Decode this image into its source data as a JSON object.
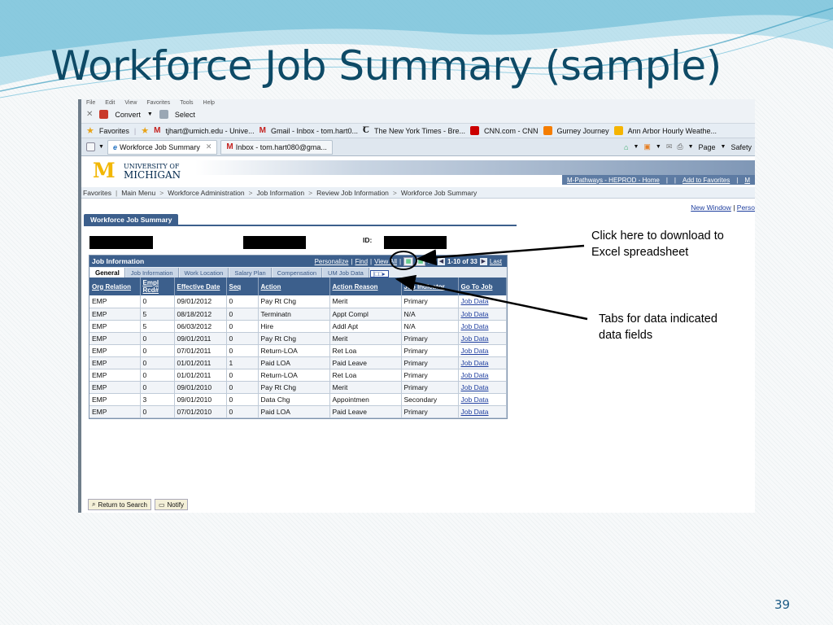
{
  "slide": {
    "title": "Workforce Job Summary (sample)",
    "number": "39",
    "colors": {
      "title": "#0e4a66",
      "wave": "#7fc6dd",
      "accent": "#3c5f8c"
    }
  },
  "browser": {
    "menu_items": [
      "File",
      "Edit",
      "View",
      "Favorites",
      "Tools",
      "Help"
    ],
    "command_bar": {
      "convert": "Convert",
      "select": "Select"
    },
    "favorites": {
      "label": "Favorites",
      "items": [
        "tjhart@umich.edu - Unive...",
        "Gmail - Inbox - tom.hart0...",
        "The New York Times - Bre...",
        "CNN.com - CNN",
        "Gurney Journey",
        "Ann Arbor Hourly Weathe..."
      ]
    },
    "tabs": [
      {
        "label": "Workforce Job Summary",
        "active": true
      },
      {
        "label": "Inbox - tom.hart080@gma...",
        "active": false
      }
    ],
    "tools": {
      "page": "Page",
      "safety": "Safety"
    }
  },
  "app": {
    "logo": {
      "line1": "UNIVERSITY OF",
      "line2": "MICHIGAN"
    },
    "banner_links": [
      "M-Pathways - HEPROD - Home",
      "Add to Favorites",
      "M"
    ],
    "breadcrumbs": [
      "Favorites",
      "Main Menu",
      "Workforce Administration",
      "Job Information",
      "Review Job Information",
      "Workforce Job Summary"
    ],
    "top_links": {
      "new_window": "New Window",
      "personalize": "Perso"
    },
    "page_tab": "Workforce Job Summary",
    "id_label": "ID:",
    "grid": {
      "title": "Job Information",
      "nav": {
        "personalize": "Personalize",
        "find": "Find",
        "view_all": "View All",
        "first": "rst",
        "range": "1-10 of 33",
        "last": "Last"
      },
      "tabs": [
        "General",
        "Job Information",
        "Work Location",
        "Salary Plan",
        "Compensation",
        "UM Job Data"
      ],
      "more_tab": "|□□▸",
      "columns": [
        "Org Relation",
        "Empl Rcd#",
        "Effective Date",
        "Seq",
        "Action",
        "Action Reason",
        "Job Indicator",
        "Go To Job"
      ],
      "rows": [
        [
          "EMP",
          "0",
          "09/01/2012",
          "0",
          "Pay Rt Chg",
          "Merit",
          "Primary",
          "Job Data"
        ],
        [
          "EMP",
          "5",
          "08/18/2012",
          "0",
          "Terminatn",
          "Appt Compl",
          "N/A",
          "Job Data"
        ],
        [
          "EMP",
          "5",
          "06/03/2012",
          "0",
          "Hire",
          "Addl Apt",
          "N/A",
          "Job Data"
        ],
        [
          "EMP",
          "0",
          "09/01/2011",
          "0",
          "Pay Rt Chg",
          "Merit",
          "Primary",
          "Job Data"
        ],
        [
          "EMP",
          "0",
          "07/01/2011",
          "0",
          "Return-LOA",
          "Ret Loa",
          "Primary",
          "Job Data"
        ],
        [
          "EMP",
          "0",
          "01/01/2011",
          "1",
          "Paid LOA",
          "Paid Leave",
          "Primary",
          "Job Data"
        ],
        [
          "EMP",
          "0",
          "01/01/2011",
          "0",
          "Return-LOA",
          "Ret Loa",
          "Primary",
          "Job Data"
        ],
        [
          "EMP",
          "0",
          "09/01/2010",
          "0",
          "Pay Rt Chg",
          "Merit",
          "Primary",
          "Job Data"
        ],
        [
          "EMP",
          "3",
          "09/01/2010",
          "0",
          "Data Chg",
          "Appointmen",
          "Secondary",
          "Job Data"
        ],
        [
          "EMP",
          "0",
          "07/01/2010",
          "0",
          "Paid LOA",
          "Paid Leave",
          "Primary",
          "Job Data"
        ]
      ]
    },
    "footer_buttons": {
      "return": "Return to Search",
      "notify": "Notify"
    }
  },
  "callouts": {
    "excel": [
      "Click here to download to",
      "Excel spreadsheet"
    ],
    "tabs": [
      "Tabs for data indicated",
      "data fields"
    ]
  }
}
